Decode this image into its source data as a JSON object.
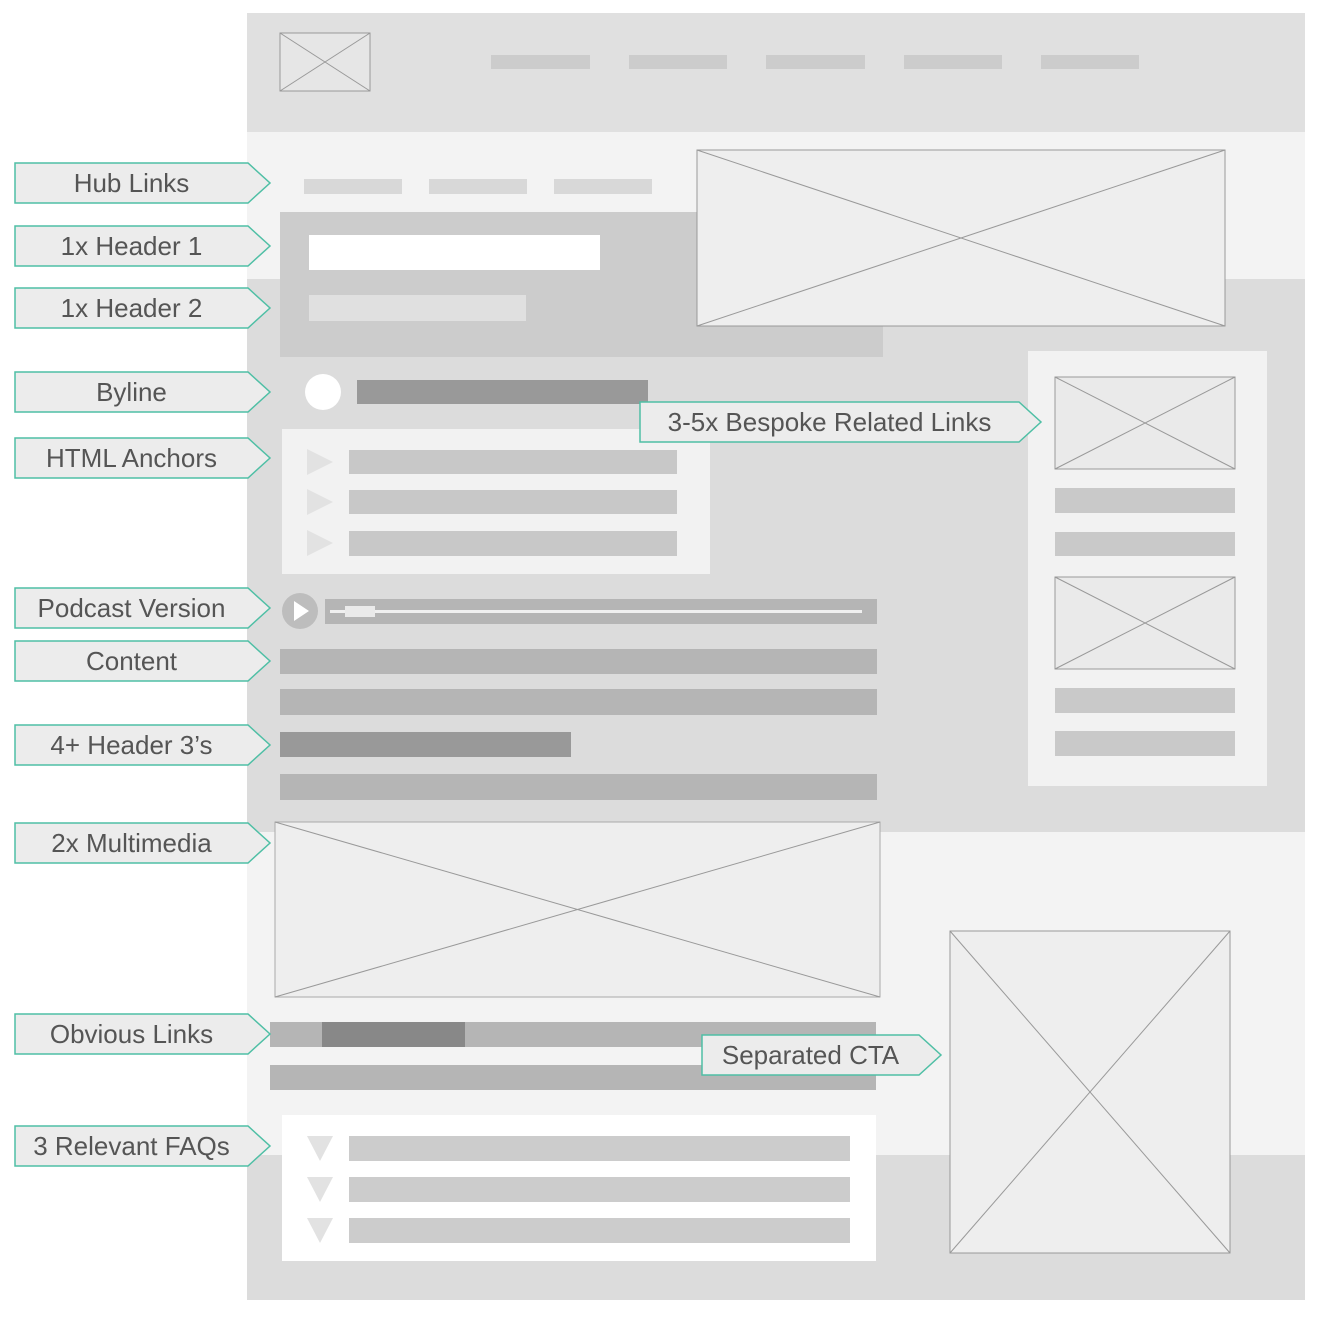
{
  "annotations": {
    "hub_links": "Hub Links",
    "header1": "1x Header 1",
    "header2": "1x Header 2",
    "byline": "Byline",
    "html_anchors": "HTML Anchors",
    "podcast": "Podcast Version",
    "content": "Content",
    "header3": "4+ Header 3’s",
    "multimedia": "2x Multimedia",
    "obvious_links": "Obvious Links",
    "faqs": "3 Relevant FAQs",
    "related_links": "3-5x Bespoke Related Links",
    "cta": "Separated CTA"
  },
  "colors": {
    "annotation_border": "#4fbfa5",
    "annotation_fill": "#ececec",
    "annotation_text": "#555555",
    "placeholder_bar": "#c9c9c9",
    "dark_bar": "#999999"
  },
  "icons": {
    "image_placeholder": "crossed-box",
    "anchor_bullet": "triangle-right",
    "faq_toggle": "triangle-down",
    "podcast_play": "play-circle"
  }
}
